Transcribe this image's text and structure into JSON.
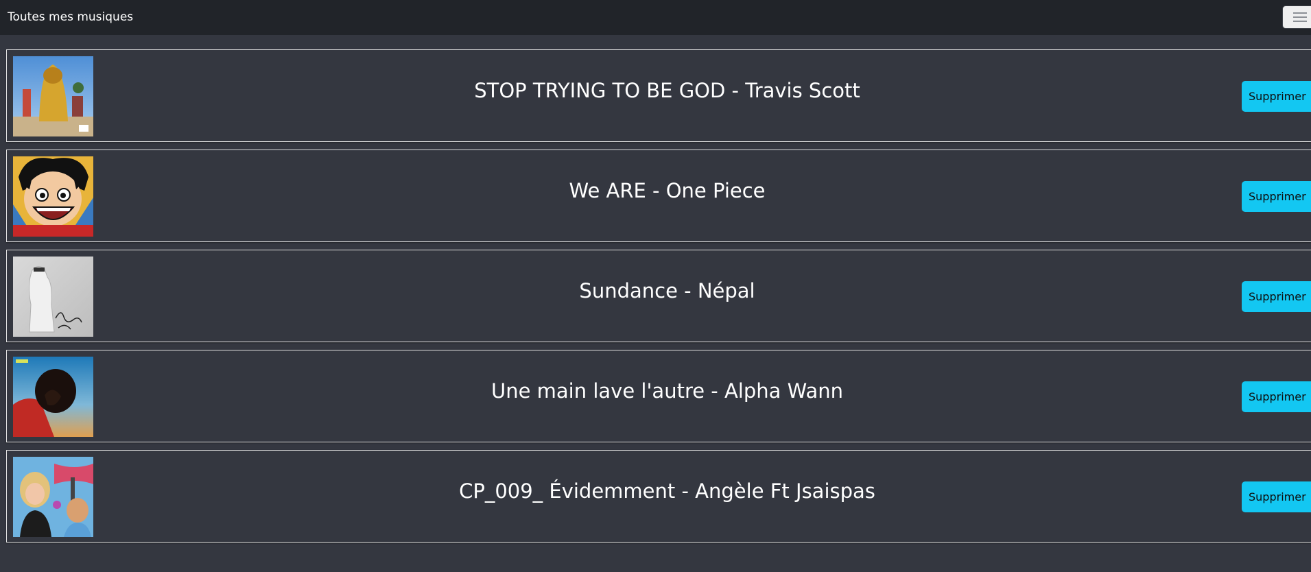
{
  "navbar": {
    "title": "Toutes mes musiques",
    "toggle_icon": "hamburger-menu-icon"
  },
  "tracks": [
    {
      "title": "STOP TRYING TO BE GOD - Travis Scott",
      "delete_label": "Supprimer",
      "cover_icon": "album-cover-image"
    },
    {
      "title": "We ARE - One Piece",
      "delete_label": "Supprimer",
      "cover_icon": "album-cover-image"
    },
    {
      "title": "Sundance - Népal",
      "delete_label": "Supprimer",
      "cover_icon": "album-cover-image"
    },
    {
      "title": "Une main lave l'autre - Alpha Wann",
      "delete_label": "Supprimer",
      "cover_icon": "album-cover-image"
    },
    {
      "title": "CP_009_ Évidemment - Angèle Ft Jsaispas",
      "delete_label": "Supprimer",
      "cover_icon": "album-cover-image"
    }
  ],
  "colors": {
    "background": "#343740",
    "navbar": "#212429",
    "button": "#13c7f2",
    "card_border": "#e3e3e3"
  }
}
